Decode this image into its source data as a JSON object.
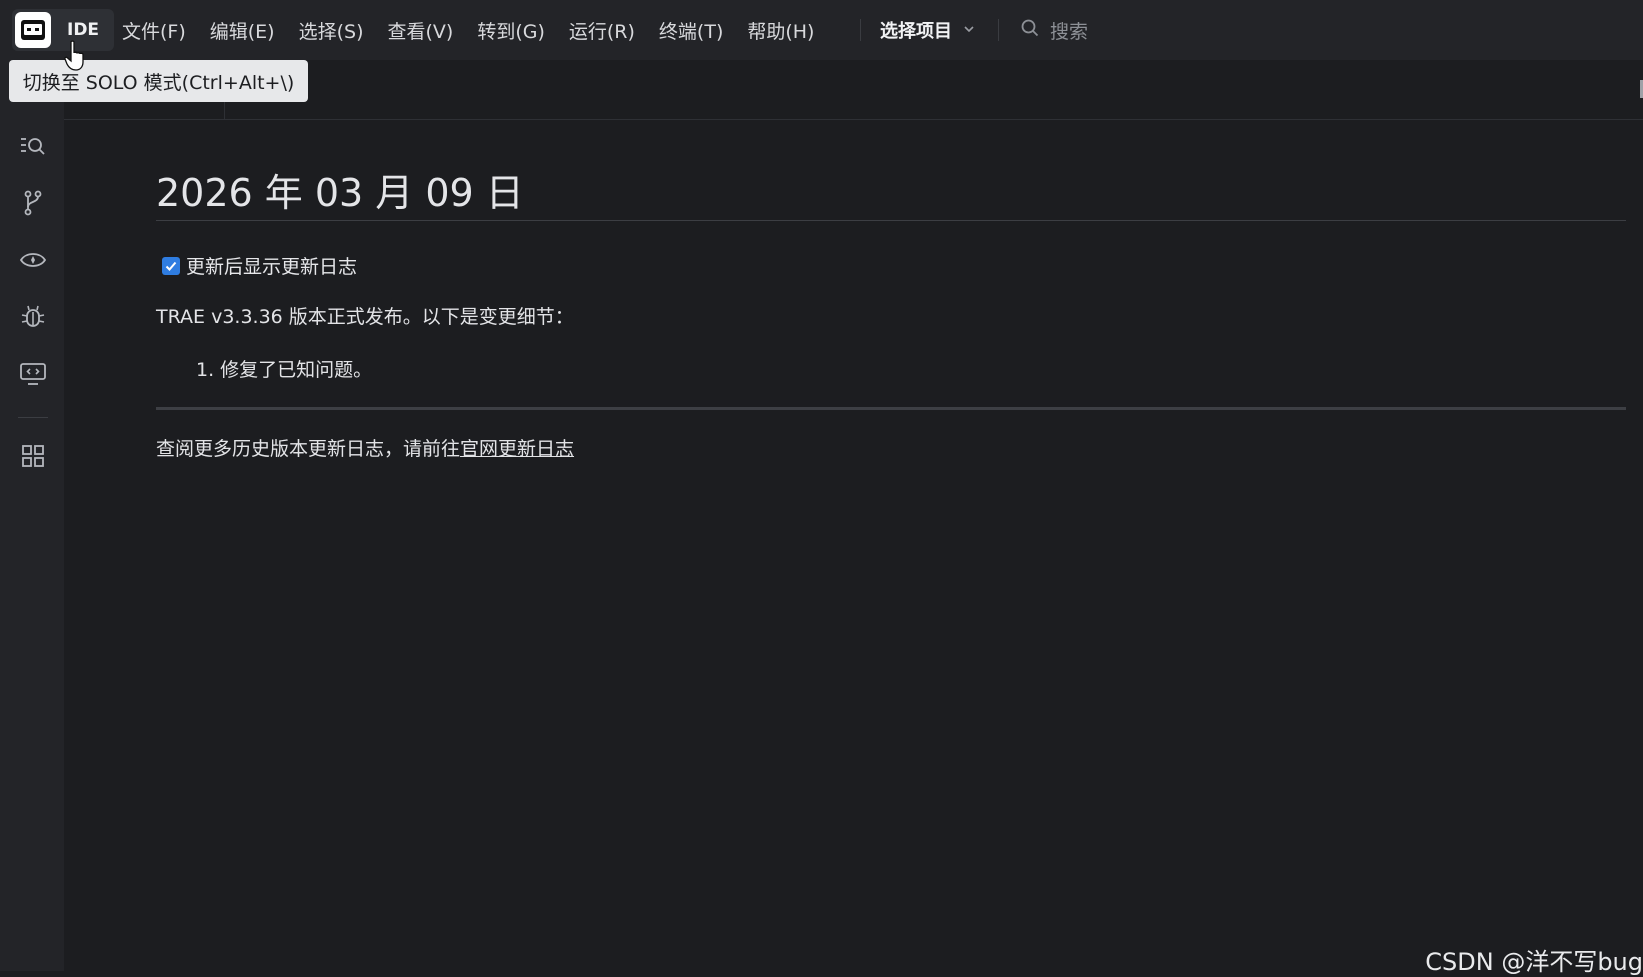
{
  "titlebar": {
    "mode_label": "IDE",
    "menu": [
      "文件(F)",
      "编辑(E)",
      "选择(S)",
      "查看(V)",
      "转到(G)",
      "运行(R)",
      "终端(T)",
      "帮助(H)"
    ],
    "project_select_label": "选择项目",
    "search_label": "搜索"
  },
  "tooltip": {
    "text": "切换至 SOLO 模式(Ctrl+Alt+\\)"
  },
  "activity_bar": {
    "icons": [
      "search-list-icon",
      "source-control-icon",
      "eye-icon",
      "debug-icon",
      "remote-display-icon",
      "extensions-grid-icon"
    ]
  },
  "content": {
    "title": "2026 年 03 月 09 日",
    "checkbox_label": "更新后显示更新日志",
    "checkbox_checked": true,
    "release_text": "TRAE v3.3.36 版本正式发布。以下是变更细节：",
    "changes": [
      "1. 修复了已知问题。"
    ],
    "footer_prefix": "查阅更多历史版本更新日志，请前往",
    "footer_link": "官网更新日志"
  },
  "watermark": "CSDN @洋不写bug",
  "colors": {
    "background": "#1c1d20",
    "titlebar": "#232428",
    "checkbox_accent": "#2f7de1",
    "tooltip_bg": "#e7e8ea"
  }
}
